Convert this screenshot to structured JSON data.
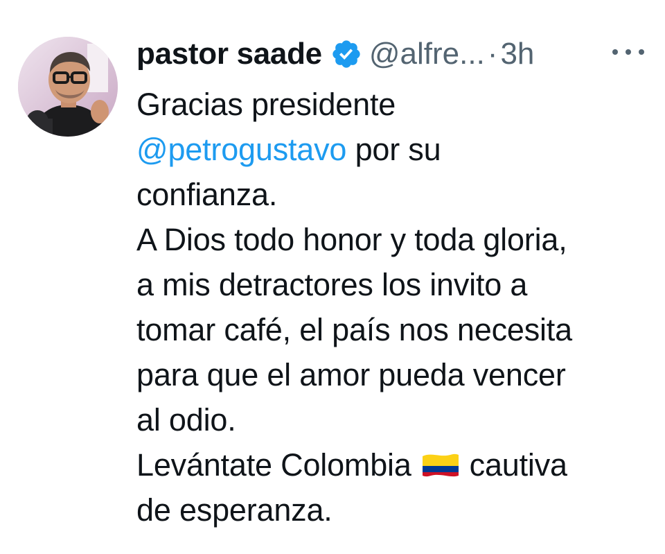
{
  "tweet": {
    "display_name": "pastor saade",
    "handle": "@alfre...",
    "separator": "·",
    "time": "3h",
    "lines": {
      "l1": "Gracias presidente",
      "mention": "@petrogustavo",
      "l2_rest": " por su",
      "l3": "confianza.",
      "l4": "A Dios todo honor y toda gloria,",
      "l5": "a mis detractores los invito a",
      "l6": "tomar café, el país nos necesita",
      "l7": "para que el amor pueda vencer",
      "l8": "al odio.",
      "l9_a": "Levántate Colombia",
      "l9_b": "cautiva",
      "l10": "de esperanza."
    }
  },
  "colors": {
    "text": "#0f1419",
    "secondary": "#536471",
    "link": "#1d9bf0",
    "verified": "#1d9bf0",
    "flag_yellow": "#fcd116",
    "flag_blue": "#003893",
    "flag_red": "#ce1126"
  },
  "icons": {
    "avatar": "profile-photo",
    "verified": "verified-badge-icon",
    "more": "more-horizontal-icon",
    "flag": "colombia-flag-emoji"
  }
}
